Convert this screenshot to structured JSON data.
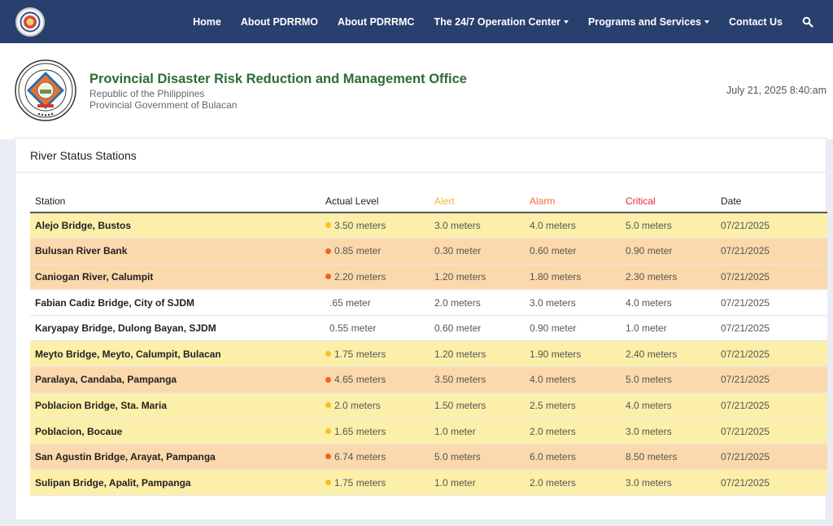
{
  "nav": {
    "items": [
      {
        "label": "Home",
        "dropdown": false
      },
      {
        "label": "About PDRRMO",
        "dropdown": false
      },
      {
        "label": "About PDRRMC",
        "dropdown": false
      },
      {
        "label": "The 24/7 Operation Center",
        "dropdown": true
      },
      {
        "label": "Programs and Services",
        "dropdown": true
      },
      {
        "label": "Contact Us",
        "dropdown": false
      }
    ],
    "search_icon": "search-icon"
  },
  "header": {
    "title": "Provincial Disaster Risk Reduction and Management Office",
    "subtitle1": "Republic of the Philippines",
    "subtitle2": "Provincial Government of Bulacan",
    "datetime": "July 21, 2025 8:40:am"
  },
  "river": {
    "title": "River Status Stations",
    "columns": [
      "Station",
      "Actual Level",
      "Alert",
      "Alarm",
      "Critical",
      "Date"
    ],
    "rows": [
      {
        "station": "Alejo Bridge, Bustos",
        "level": "3.50 meters",
        "alert": "3.0 meters",
        "alarm": "4.0 meters",
        "critical": "5.0 meters",
        "date": "07/21/2025",
        "status": "alert"
      },
      {
        "station": "Bulusan River Bank",
        "level": "0.85 meter",
        "alert": "0.30 meter",
        "alarm": "0.60 meter",
        "critical": "0.90 meter",
        "date": "07/21/2025",
        "status": "alarm"
      },
      {
        "station": "Caniogan River, Calumpit",
        "level": "2.20 meters",
        "alert": "1.20 meters",
        "alarm": "1.80 meters",
        "critical": "2.30 meters",
        "date": "07/21/2025",
        "status": "alarm"
      },
      {
        "station": "Fabian Cadiz Bridge, City of SJDM",
        "level": ".65 meter",
        "alert": "2.0 meters",
        "alarm": "3.0 meters",
        "critical": "4.0 meters",
        "date": "07/21/2025",
        "status": "normal"
      },
      {
        "station": "Karyapay Bridge, Dulong Bayan, SJDM",
        "level": "0.55 meter",
        "alert": "0.60 meter",
        "alarm": "0.90 meter",
        "critical": "1.0 meter",
        "date": "07/21/2025",
        "status": "normal"
      },
      {
        "station": "Meyto Bridge, Meyto, Calumpit, Bulacan",
        "level": "1.75 meters",
        "alert": "1.20 meters",
        "alarm": "1.90 meters",
        "critical": "2.40 meters",
        "date": "07/21/2025",
        "status": "alert"
      },
      {
        "station": "Paralaya, Candaba, Pampanga",
        "level": "4.65 meters",
        "alert": "3.50 meters",
        "alarm": "4.0 meters",
        "critical": "5.0 meters",
        "date": "07/21/2025",
        "status": "alarm"
      },
      {
        "station": "Poblacion Bridge, Sta. Maria",
        "level": "2.0 meters",
        "alert": "1.50 meters",
        "alarm": "2.5 meters",
        "critical": "4.0 meters",
        "date": "07/21/2025",
        "status": "alert"
      },
      {
        "station": "Poblacion, Bocaue",
        "level": "1.65 meters",
        "alert": "1.0 meter",
        "alarm": "2.0 meters",
        "critical": "3.0 meters",
        "date": "07/21/2025",
        "status": "alert"
      },
      {
        "station": "San Agustin Bridge, Arayat, Pampanga",
        "level": "6.74 meters",
        "alert": "5.0 meters",
        "alarm": "6.0 meters",
        "critical": "8.50 meters",
        "date": "07/21/2025",
        "status": "alarm"
      },
      {
        "station": "Sulipan Bridge, Apalit, Pampanga",
        "level": "1.75 meters",
        "alert": "1.0 meter",
        "alarm": "2.0 meters",
        "critical": "3.0 meters",
        "date": "07/21/2025",
        "status": "alert"
      }
    ]
  },
  "colors": {
    "nav_bg": "#28406d",
    "title_green": "#2e6b35",
    "alert": "#f2b63a",
    "alarm": "#ef6a3b",
    "critical": "#d8293e",
    "alert_row": "#fcefa9",
    "alarm_row": "#fcd9ad"
  }
}
